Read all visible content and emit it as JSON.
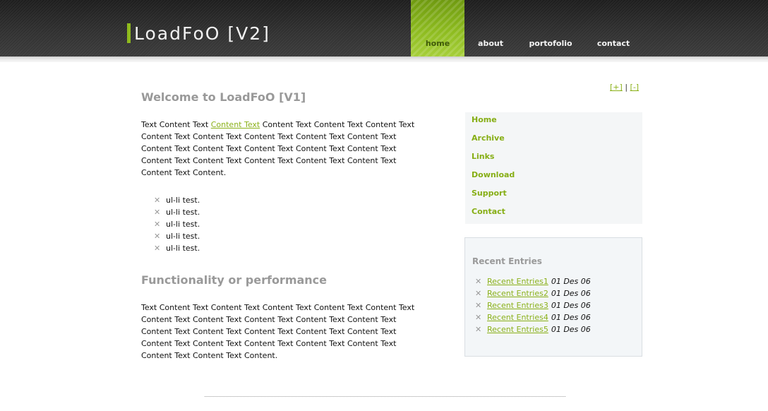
{
  "header": {
    "logo": "LoadFoO [V2]",
    "nav": [
      {
        "label": "home",
        "active": true
      },
      {
        "label": "about",
        "active": false
      },
      {
        "label": "portofolio",
        "active": false
      },
      {
        "label": "contact",
        "active": false
      }
    ]
  },
  "main": {
    "heading1": "Welcome to LoadFoO [V1]",
    "para1": {
      "pre": "Text Content Text ",
      "link": "Content Text",
      "post": " Content Text Content Text Content Text Content Text Content Text Content Text Content Text Content Text Content Text Content Text Content Text Content Text Content Text Content Text Content Text Content Text Content Text Content Text Content Text Content."
    },
    "bullets": [
      "ul-li test.",
      "ul-li test.",
      "ul-li test.",
      "ul-li test.",
      "ul-li test."
    ],
    "heading2": "Functionality or performance",
    "para2": "Text Content Text Content Text Content Text Content Text Content Text Content Text Content Text Content Text Content Text Content Text Content Text Content Text Content Text Content Text Content Text Content Text Content Text Content Text Content Text Content Text Content Text Content Text Content."
  },
  "sidebar": {
    "font_size_increase": "[+]",
    "font_size_separator": "|",
    "font_size_decrease": "[-]",
    "menu": [
      "Home",
      "Archive",
      "Links",
      "Download",
      "Support",
      "Contact"
    ],
    "recent_title": "Recent Entries",
    "recent_entries": [
      {
        "label": "Recent Entries1",
        "date": "01 Des 06"
      },
      {
        "label": "Recent Entries2",
        "date": "01 Des 06"
      },
      {
        "label": "Recent Entries3",
        "date": "01 Des 06"
      },
      {
        "label": "Recent Entries4",
        "date": "01 Des 06"
      },
      {
        "label": "Recent Entries5",
        "date": "01 Des 06"
      }
    ]
  },
  "icons": {
    "bullet": "x-mark-icon",
    "bullet_glyph": "✕"
  },
  "colors": {
    "accent": "#8bb11a",
    "header_bg": "#2b2b2b",
    "heading": "#999999"
  }
}
